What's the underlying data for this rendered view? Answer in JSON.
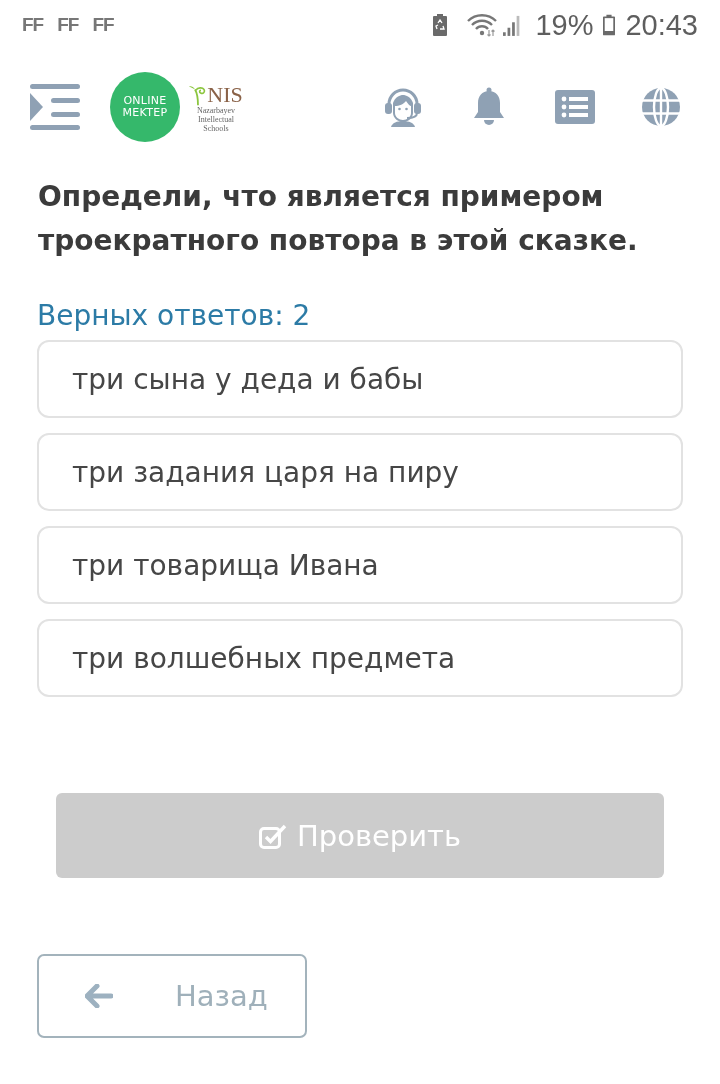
{
  "status_bar": {
    "notifications": [
      "FF",
      "FF",
      "FF"
    ],
    "battery_percent": "19%",
    "time": "20:43"
  },
  "header": {
    "logo": {
      "lines": [
        "ONLINE",
        "MEKTEP"
      ]
    },
    "partner_logo": {
      "name": "NIS",
      "subtitle": [
        "Nazarbayev",
        "Intellectual",
        "Schools"
      ]
    }
  },
  "question": {
    "text": "Определи, что является примером троекратного повтора в этой сказке.",
    "answers_hint": "Верных ответов: 2"
  },
  "options": [
    {
      "label": "три сына у деда и бабы",
      "selected": false
    },
    {
      "label": "три задания царя на пиру",
      "selected": false
    },
    {
      "label": "три товарища Ивана",
      "selected": false
    },
    {
      "label": "три волшебных предмета",
      "selected": false
    }
  ],
  "check_button": {
    "label": "Проверить",
    "disabled": true
  },
  "back_button": {
    "label": "Назад"
  }
}
